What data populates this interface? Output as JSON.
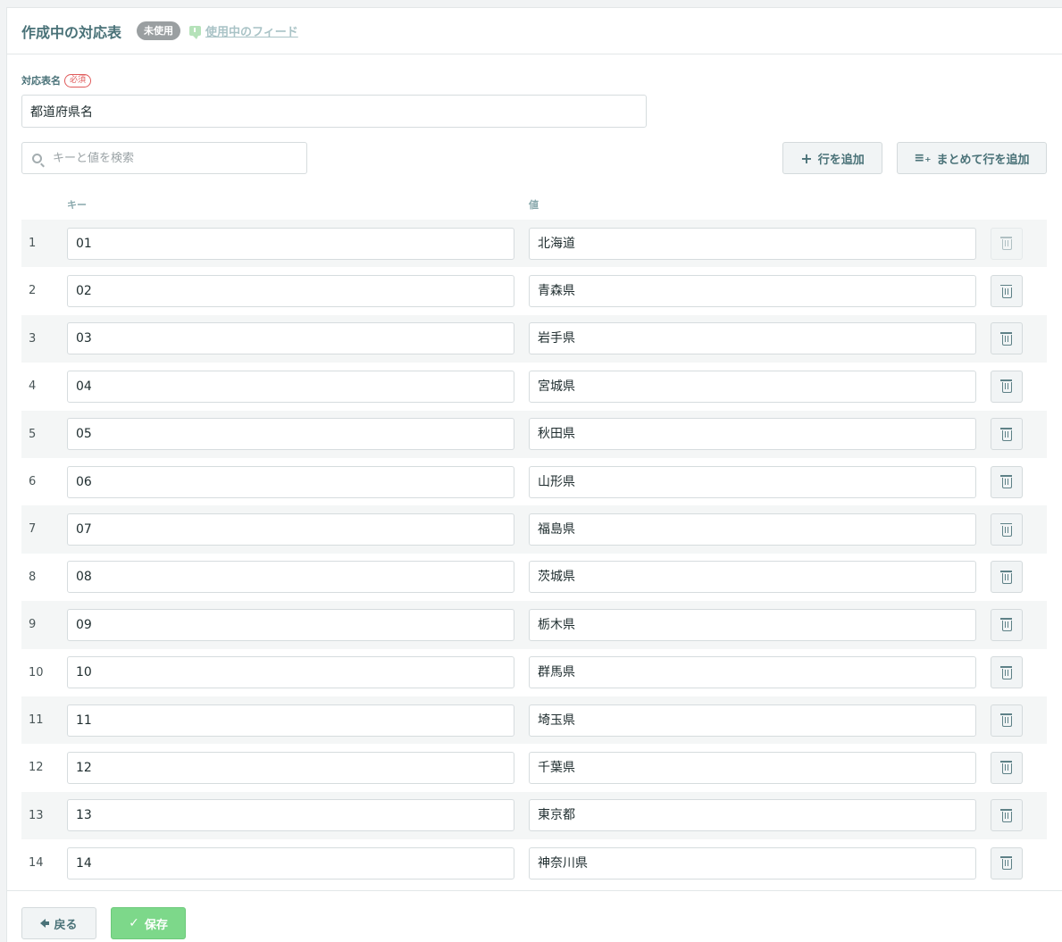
{
  "header": {
    "title": "作成中の対応表",
    "status_badge": "未使用",
    "feed_link": "使用中のフィード"
  },
  "form": {
    "name_label": "対応表名",
    "required_badge": "必須",
    "name_value": "都道府県名",
    "search_placeholder": "キーと値を検索"
  },
  "toolbar": {
    "add_row_label": "行を追加",
    "bulk_add_label": "まとめて行を追加"
  },
  "table": {
    "key_header": "キー",
    "value_header": "値",
    "rows": [
      {
        "num": "1",
        "key": "01",
        "value": "北海道"
      },
      {
        "num": "2",
        "key": "02",
        "value": "青森県"
      },
      {
        "num": "3",
        "key": "03",
        "value": "岩手県"
      },
      {
        "num": "4",
        "key": "04",
        "value": "宮城県"
      },
      {
        "num": "5",
        "key": "05",
        "value": "秋田県"
      },
      {
        "num": "6",
        "key": "06",
        "value": "山形県"
      },
      {
        "num": "7",
        "key": "07",
        "value": "福島県"
      },
      {
        "num": "8",
        "key": "08",
        "value": "茨城県"
      },
      {
        "num": "9",
        "key": "09",
        "value": "栃木県"
      },
      {
        "num": "10",
        "key": "10",
        "value": "群馬県"
      },
      {
        "num": "11",
        "key": "11",
        "value": "埼玉県"
      },
      {
        "num": "12",
        "key": "12",
        "value": "千葉県"
      },
      {
        "num": "13",
        "key": "13",
        "value": "東京都"
      },
      {
        "num": "14",
        "key": "14",
        "value": "神奈川県"
      }
    ]
  },
  "footer": {
    "back_label": "戻る",
    "save_label": "保存"
  },
  "icons": {
    "feed": "comment-icon",
    "search": "search-icon",
    "add_row": "plus-icon",
    "bulk_add": "list-add-icon",
    "delete": "trash-icon",
    "back": "arrow-left-icon",
    "save": "check-icon"
  },
  "colors": {
    "accent": "#4a7278",
    "save_green": "#7dd88a",
    "required_red": "#e05a5a",
    "badge_gray": "#9a9fa1"
  }
}
